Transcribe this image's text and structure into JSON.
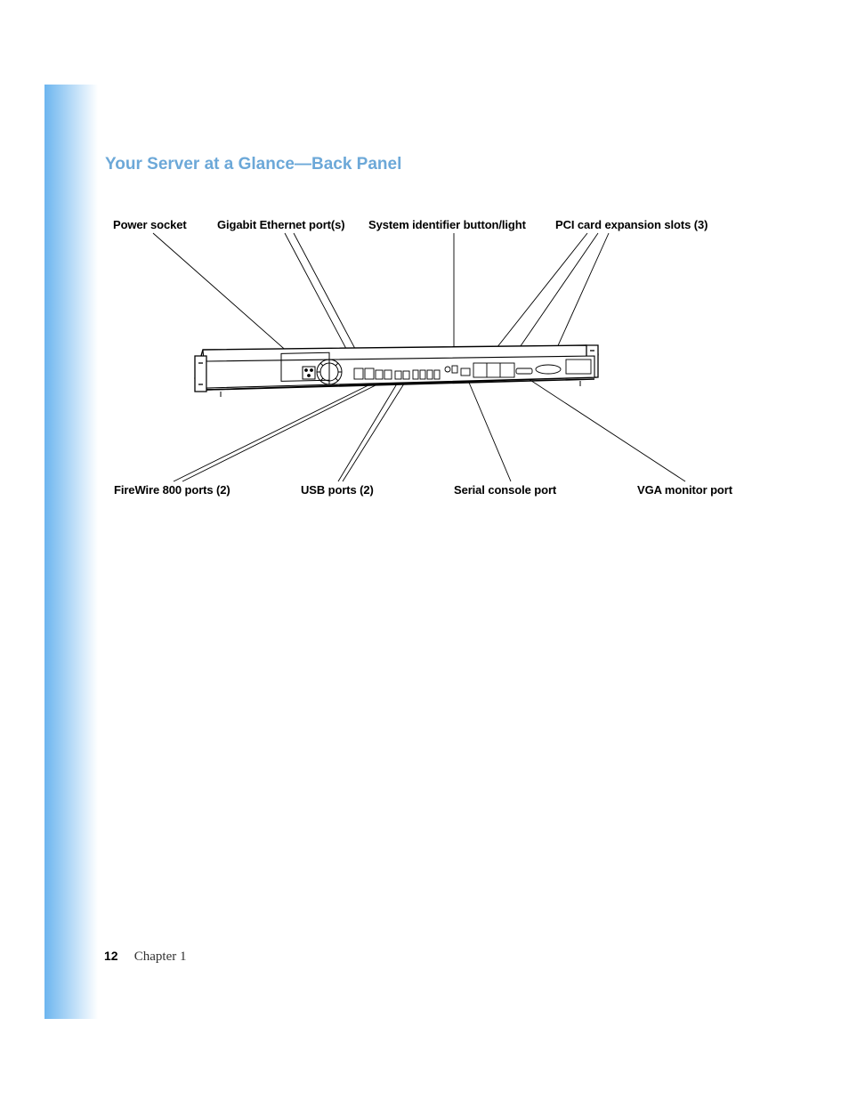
{
  "heading": "Your Server at a Glance—Back Panel",
  "labels": {
    "power_socket": "Power socket",
    "gigabit_ethernet": "Gigabit Ethernet port(s)",
    "system_identifier": "System identifier button/light",
    "pci_slots": "PCI card expansion slots (3)",
    "firewire": "FireWire 800 ports (2)",
    "usb": "USB ports (2)",
    "serial": "Serial console port",
    "vga": "VGA monitor port"
  },
  "footer": {
    "page": "12",
    "chapter": "Chapter 1"
  }
}
